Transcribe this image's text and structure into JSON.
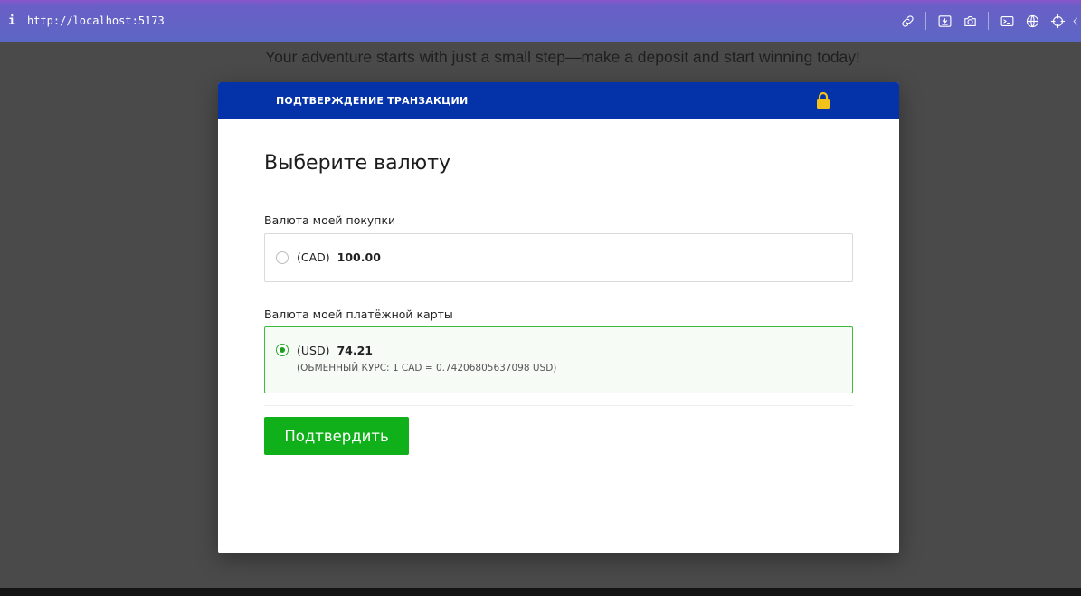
{
  "browser": {
    "info_symbol": "i",
    "url": "http://localhost:5173",
    "tools": [
      "link-icon",
      "download-icon",
      "camera-icon",
      "terminal-icon",
      "globe-icon",
      "crosshair-icon",
      "chevron-left-icon"
    ]
  },
  "page": {
    "tagline": "Your adventure starts with just a small step—make a deposit and start winning today!"
  },
  "modal": {
    "title": "ПОДТВЕРЖДЕНИЕ ТРАНЗАКЦИИ",
    "heading": "Выберите валюту",
    "purchase_label": "Валюта моей покупки",
    "card_label": "Валюта моей платёжной карты",
    "options": [
      {
        "currency": "(CAD)",
        "amount": "100.00",
        "selected": false
      },
      {
        "currency": "(USD)",
        "amount": "74.21",
        "rate": "(ОБМЕННЫЙ КУРС: 1 CAD = 0.74206805637098 USD)",
        "selected": true
      }
    ],
    "confirm_label": "Подтвердить"
  },
  "colors": {
    "header": "#0432a8",
    "accent_green": "#0fb01a",
    "lock": "#f2c21b"
  }
}
